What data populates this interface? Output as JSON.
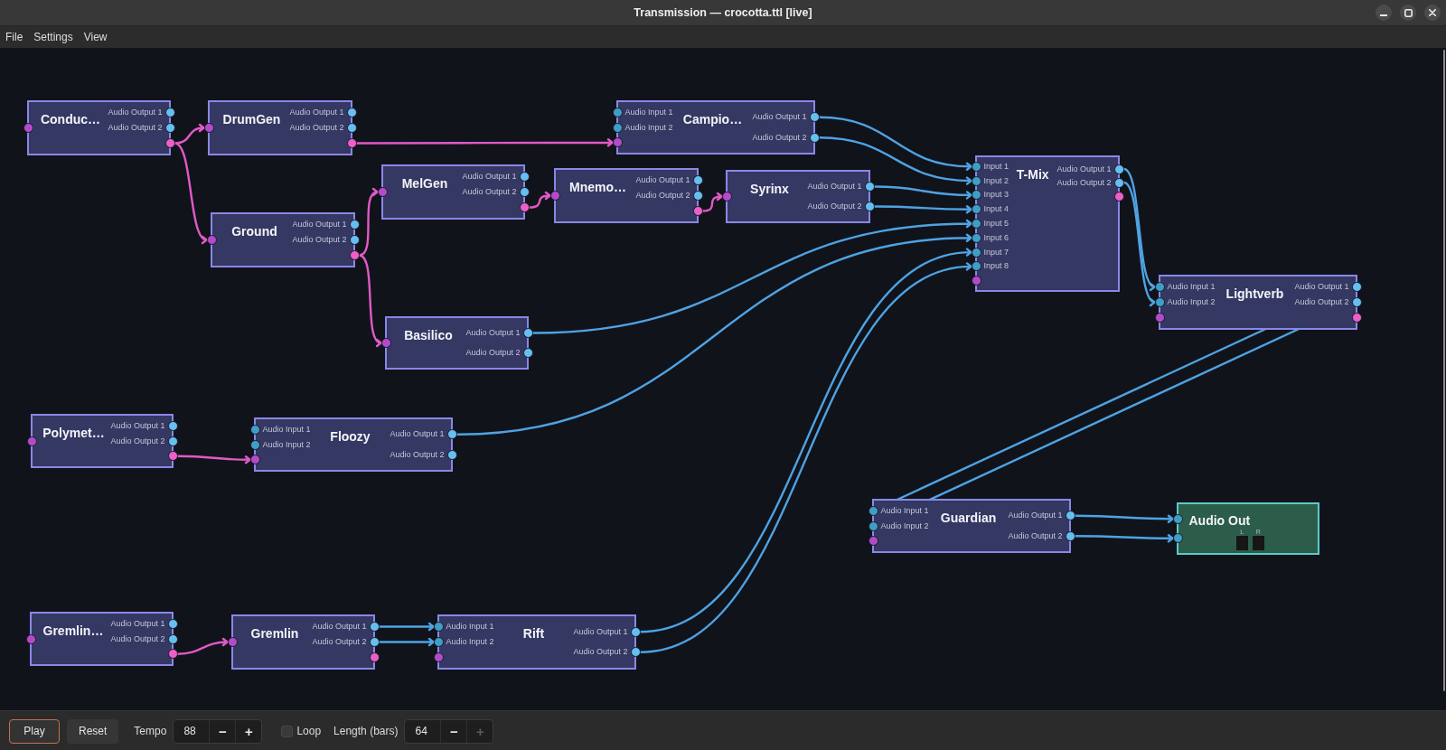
{
  "window": {
    "title": "Transmission — crocotta.ttl [live]"
  },
  "menu": [
    {
      "label": "File"
    },
    {
      "label": "Settings"
    },
    {
      "label": "View"
    }
  ],
  "graph": {
    "nodes": [
      {
        "title": "Conduc…",
        "kind": "module",
        "inputs": [
          {
            "kind": "midi"
          }
        ],
        "outputs": [
          {
            "label": "Audio Output 1",
            "kind": "audio"
          },
          {
            "label": "Audio Output 2",
            "kind": "audio"
          },
          {
            "kind": "midi"
          }
        ]
      },
      {
        "title": "DrumGen",
        "kind": "module",
        "inputs": [
          {
            "kind": "midi"
          }
        ],
        "outputs": [
          {
            "label": "Audio Output 1",
            "kind": "audio"
          },
          {
            "label": "Audio Output 2",
            "kind": "audio"
          },
          {
            "kind": "midi"
          }
        ]
      },
      {
        "title": "Campio…",
        "kind": "module",
        "inputs": [
          {
            "label": "Audio Input 1",
            "kind": "audio"
          },
          {
            "label": "Audio Input 2",
            "kind": "audio"
          },
          {
            "kind": "midi"
          }
        ],
        "outputs": [
          {
            "label": "Audio Output 1",
            "kind": "audio"
          },
          {
            "label": "Audio Output 2",
            "kind": "audio"
          }
        ]
      },
      {
        "title": "T-Mix",
        "kind": "module",
        "inputs": [
          {
            "label": "Input 1",
            "kind": "audio"
          },
          {
            "label": "Input 2",
            "kind": "audio"
          },
          {
            "label": "Input 3",
            "kind": "audio"
          },
          {
            "label": "Input 4",
            "kind": "audio"
          },
          {
            "label": "Input 5",
            "kind": "audio"
          },
          {
            "label": "Input 6",
            "kind": "audio"
          },
          {
            "label": "Input 7",
            "kind": "audio"
          },
          {
            "label": "Input 8",
            "kind": "audio"
          },
          {
            "kind": "midi"
          }
        ],
        "outputs": [
          {
            "label": "Audio Output 1",
            "kind": "audio"
          },
          {
            "label": "Audio Output 2",
            "kind": "audio"
          },
          {
            "kind": "midi"
          }
        ]
      },
      {
        "title": "MelGen",
        "kind": "module",
        "inputs": [
          {
            "kind": "midi"
          }
        ],
        "outputs": [
          {
            "label": "Audio Output 1",
            "kind": "audio"
          },
          {
            "label": "Audio Output 2",
            "kind": "audio"
          },
          {
            "kind": "midi"
          }
        ]
      },
      {
        "title": "Mnemo…",
        "kind": "module",
        "inputs": [
          {
            "kind": "midi"
          }
        ],
        "outputs": [
          {
            "label": "Audio Output 1",
            "kind": "audio"
          },
          {
            "label": "Audio Output 2",
            "kind": "audio"
          },
          {
            "kind": "midi"
          }
        ]
      },
      {
        "title": "Syrinx",
        "kind": "module",
        "inputs": [
          {
            "kind": "midi"
          }
        ],
        "outputs": [
          {
            "label": "Audio Output 1",
            "kind": "audio"
          },
          {
            "label": "Audio Output 2",
            "kind": "audio"
          }
        ]
      },
      {
        "title": "Ground",
        "kind": "module",
        "inputs": [
          {
            "kind": "midi"
          }
        ],
        "outputs": [
          {
            "label": "Audio Output 1",
            "kind": "audio"
          },
          {
            "label": "Audio Output 2",
            "kind": "audio"
          },
          {
            "kind": "midi"
          }
        ]
      },
      {
        "title": "Lightverb",
        "kind": "module",
        "inputs": [
          {
            "label": "Audio Input 1",
            "kind": "audio"
          },
          {
            "label": "Audio Input 2",
            "kind": "audio"
          },
          {
            "kind": "midi"
          }
        ],
        "outputs": [
          {
            "label": "Audio Output 1",
            "kind": "audio"
          },
          {
            "label": "Audio Output 2",
            "kind": "audio"
          },
          {
            "kind": "midi"
          }
        ]
      },
      {
        "title": "Basilico",
        "kind": "module",
        "inputs": [
          {
            "kind": "midi"
          }
        ],
        "outputs": [
          {
            "label": "Audio Output 1",
            "kind": "audio"
          },
          {
            "label": "Audio Output 2",
            "kind": "audio"
          }
        ]
      },
      {
        "title": "Polymet…",
        "kind": "module",
        "inputs": [
          {
            "kind": "midi"
          }
        ],
        "outputs": [
          {
            "label": "Audio Output 1",
            "kind": "audio"
          },
          {
            "label": "Audio Output 2",
            "kind": "audio"
          },
          {
            "kind": "midi"
          }
        ]
      },
      {
        "title": "Floozy",
        "kind": "module",
        "inputs": [
          {
            "label": "Audio Input 1",
            "kind": "audio"
          },
          {
            "label": "Audio Input 2",
            "kind": "audio"
          },
          {
            "kind": "midi"
          }
        ],
        "outputs": [
          {
            "label": "Audio Output 1",
            "kind": "audio"
          },
          {
            "label": "Audio Output 2",
            "kind": "audio"
          }
        ]
      },
      {
        "title": "Guardian",
        "kind": "module",
        "inputs": [
          {
            "label": "Audio Input 1",
            "kind": "audio"
          },
          {
            "label": "Audio Input 2",
            "kind": "audio"
          },
          {
            "kind": "midi"
          }
        ],
        "outputs": [
          {
            "label": "Audio Output 1",
            "kind": "audio"
          },
          {
            "label": "Audio Output 2",
            "kind": "audio"
          }
        ]
      },
      {
        "title": "Audio Out",
        "kind": "output",
        "inputs": [
          {
            "kind": "audio"
          },
          {
            "kind": "audio"
          }
        ],
        "meters": [
          {
            "label": "L",
            "level": 0
          },
          {
            "label": "R",
            "level": 0
          }
        ]
      },
      {
        "title": "Gremlin…",
        "kind": "module",
        "inputs": [
          {
            "kind": "midi"
          }
        ],
        "outputs": [
          {
            "label": "Audio Output 1",
            "kind": "audio"
          },
          {
            "label": "Audio Output 2",
            "kind": "audio"
          },
          {
            "kind": "midi"
          }
        ]
      },
      {
        "title": "Gremlin",
        "kind": "module",
        "inputs": [
          {
            "kind": "midi"
          }
        ],
        "outputs": [
          {
            "label": "Audio Output 1",
            "kind": "audio"
          },
          {
            "label": "Audio Output 2",
            "kind": "audio"
          },
          {
            "kind": "midi"
          }
        ]
      },
      {
        "title": "Rift",
        "kind": "module",
        "inputs": [
          {
            "label": "Audio Input 1",
            "kind": "audio"
          },
          {
            "label": "Audio Input 2",
            "kind": "audio"
          },
          {
            "kind": "midi"
          }
        ],
        "outputs": [
          {
            "label": "Audio Output 1",
            "kind": "audio"
          },
          {
            "label": "Audio Output 2",
            "kind": "audio"
          }
        ]
      }
    ]
  },
  "transport": {
    "buttons": [
      {
        "label": "Play",
        "focused": true
      },
      {
        "label": "Reset",
        "focused": false
      }
    ],
    "tempo": {
      "label": "Tempo",
      "value": "88",
      "decrement": {
        "text": "−",
        "disabled": false
      },
      "increment": {
        "text": "+",
        "disabled": false
      }
    },
    "loop": {
      "label": "Loop",
      "checked": false
    },
    "length": {
      "label": "Length (bars)",
      "value": "64",
      "decrement": {
        "text": "−",
        "disabled": false
      },
      "increment": {
        "text": "+",
        "disabled": true
      }
    }
  }
}
